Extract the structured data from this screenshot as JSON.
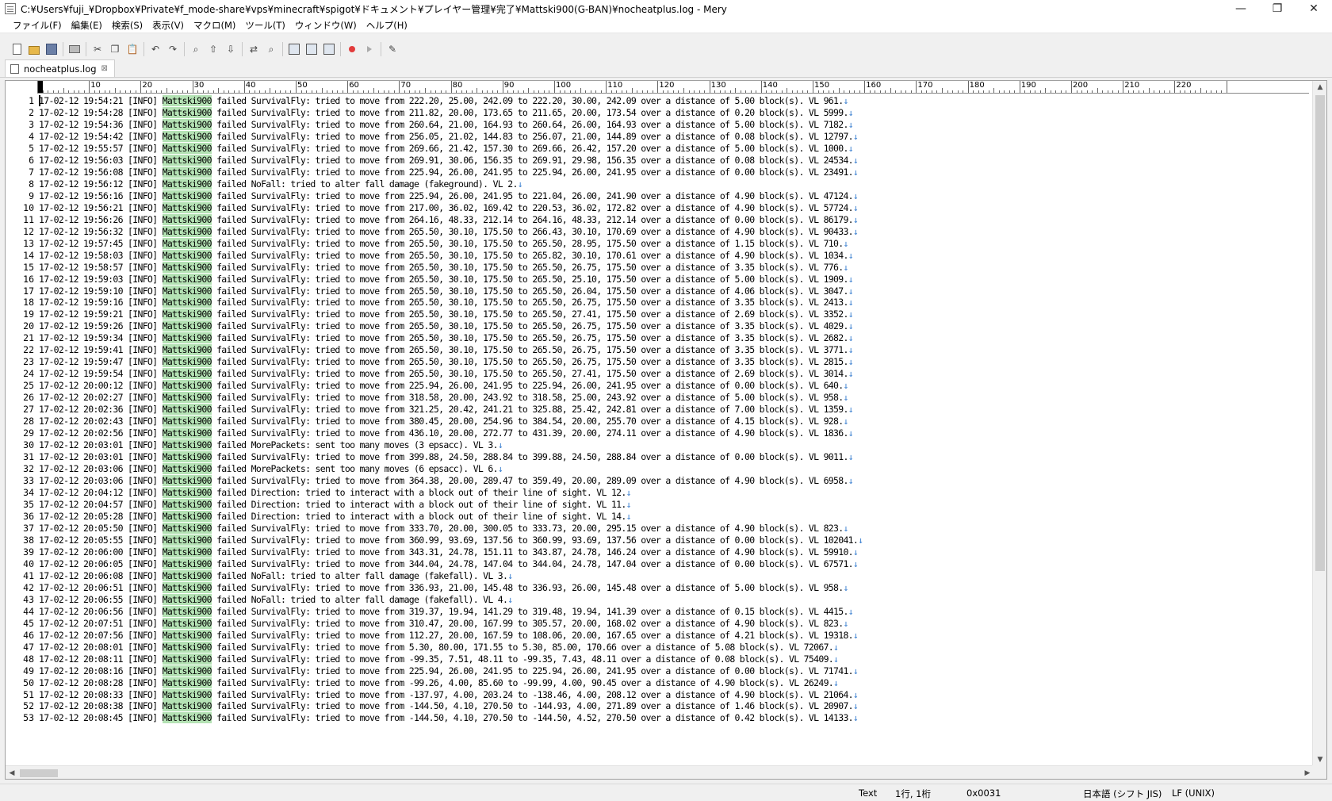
{
  "window": {
    "title": "C:¥Users¥fuji_¥Dropbox¥Private¥f_mode-share¥vps¥minecraft¥spigot¥ドキュメント¥プレイヤー管理¥完了¥Mattski900(G-BAN)¥nocheatplus.log - Mery",
    "minimize": "—",
    "maximize": "❐",
    "close": "✕"
  },
  "menu": [
    "ファイル(F)",
    "編集(E)",
    "検索(S)",
    "表示(V)",
    "マクロ(M)",
    "ツール(T)",
    "ウィンドウ(W)",
    "ヘルプ(H)"
  ],
  "toolbar": {
    "icons": [
      "new-file-icon",
      "open-folder-icon",
      "save-icon",
      "|",
      "print-icon",
      "|",
      "cut-icon",
      "copy-icon",
      "paste-icon",
      "|",
      "undo-icon",
      "redo-icon",
      "|",
      "find-icon",
      "find-up-icon",
      "find-down-icon",
      "|",
      "replace-icon",
      "find-files-icon",
      "|",
      "panel-left-icon",
      "panel-output-icon",
      "panel-split-icon",
      "|",
      "record-macro-icon",
      "play-macro-icon",
      "|",
      "options-icon"
    ]
  },
  "tab": {
    "label": "nocheatplus.log",
    "close": "⊠"
  },
  "ruler": {
    "labels": [
      "10",
      "20",
      "30",
      "40",
      "50",
      "60",
      "70",
      "80",
      "90",
      "100",
      "110",
      "120",
      "130",
      "140",
      "150",
      "160",
      "170",
      "180",
      "190",
      "200",
      "210",
      "220"
    ]
  },
  "editor": {
    "player": "Mattski900",
    "eol_mark": "↓",
    "lines": [
      {
        "n": "1",
        "pre": "17-02-12 19:54:21 [INFO] ",
        "post": " failed SurvivalFly: tried to move from 222.20, 25.00, 242.09 to 222.20, 30.00, 242.09 over a distance of 5.00 block(s). VL 961."
      },
      {
        "n": "2",
        "pre": "17-02-12 19:54:28 [INFO] ",
        "post": " failed SurvivalFly: tried to move from 211.82, 20.00, 173.65 to 211.65, 20.00, 173.54 over a distance of 0.20 block(s). VL 5999."
      },
      {
        "n": "3",
        "pre": "17-02-12 19:54:36 [INFO] ",
        "post": " failed SurvivalFly: tried to move from 260.64, 21.00, 164.93 to 260.64, 26.00, 164.93 over a distance of 5.00 block(s). VL 7182."
      },
      {
        "n": "4",
        "pre": "17-02-12 19:54:42 [INFO] ",
        "post": " failed SurvivalFly: tried to move from 256.05, 21.02, 144.83 to 256.07, 21.00, 144.89 over a distance of 0.08 block(s). VL 12797."
      },
      {
        "n": "5",
        "pre": "17-02-12 19:55:57 [INFO] ",
        "post": " failed SurvivalFly: tried to move from 269.66, 21.42, 157.30 to 269.66, 26.42, 157.20 over a distance of 5.00 block(s). VL 1000."
      },
      {
        "n": "6",
        "pre": "17-02-12 19:56:03 [INFO] ",
        "post": " failed SurvivalFly: tried to move from 269.91, 30.06, 156.35 to 269.91, 29.98, 156.35 over a distance of 0.08 block(s). VL 24534."
      },
      {
        "n": "7",
        "pre": "17-02-12 19:56:08 [INFO] ",
        "post": " failed SurvivalFly: tried to move from 225.94, 26.00, 241.95 to 225.94, 26.00, 241.95 over a distance of 0.00 block(s). VL 23491."
      },
      {
        "n": "8",
        "pre": "17-02-12 19:56:12 [INFO] ",
        "post": " failed NoFall: tried to alter fall damage (fakeground). VL 2."
      },
      {
        "n": "9",
        "pre": "17-02-12 19:56:16 [INFO] ",
        "post": " failed SurvivalFly: tried to move from 225.94, 26.00, 241.95 to 221.04, 26.00, 241.90 over a distance of 4.90 block(s). VL 47124."
      },
      {
        "n": "10",
        "pre": "17-02-12 19:56:21 [INFO] ",
        "post": " failed SurvivalFly: tried to move from 217.00, 36.02, 169.42 to 220.53, 36.02, 172.82 over a distance of 4.90 block(s). VL 57724."
      },
      {
        "n": "11",
        "pre": "17-02-12 19:56:26 [INFO] ",
        "post": " failed SurvivalFly: tried to move from 264.16, 48.33, 212.14 to 264.16, 48.33, 212.14 over a distance of 0.00 block(s). VL 86179."
      },
      {
        "n": "12",
        "pre": "17-02-12 19:56:32 [INFO] ",
        "post": " failed SurvivalFly: tried to move from 265.50, 30.10, 175.50 to 266.43, 30.10, 170.69 over a distance of 4.90 block(s). VL 90433."
      },
      {
        "n": "13",
        "pre": "17-02-12 19:57:45 [INFO] ",
        "post": " failed SurvivalFly: tried to move from 265.50, 30.10, 175.50 to 265.50, 28.95, 175.50 over a distance of 1.15 block(s). VL 710."
      },
      {
        "n": "14",
        "pre": "17-02-12 19:58:03 [INFO] ",
        "post": " failed SurvivalFly: tried to move from 265.50, 30.10, 175.50 to 265.82, 30.10, 170.61 over a distance of 4.90 block(s). VL 1034."
      },
      {
        "n": "15",
        "pre": "17-02-12 19:58:57 [INFO] ",
        "post": " failed SurvivalFly: tried to move from 265.50, 30.10, 175.50 to 265.50, 26.75, 175.50 over a distance of 3.35 block(s). VL 776."
      },
      {
        "n": "16",
        "pre": "17-02-12 19:59:03 [INFO] ",
        "post": " failed SurvivalFly: tried to move from 265.50, 30.10, 175.50 to 265.50, 25.10, 175.50 over a distance of 5.00 block(s). VL 1909."
      },
      {
        "n": "17",
        "pre": "17-02-12 19:59:10 [INFO] ",
        "post": " failed SurvivalFly: tried to move from 265.50, 30.10, 175.50 to 265.50, 26.04, 175.50 over a distance of 4.06 block(s). VL 3047."
      },
      {
        "n": "18",
        "pre": "17-02-12 19:59:16 [INFO] ",
        "post": " failed SurvivalFly: tried to move from 265.50, 30.10, 175.50 to 265.50, 26.75, 175.50 over a distance of 3.35 block(s). VL 2413."
      },
      {
        "n": "19",
        "pre": "17-02-12 19:59:21 [INFO] ",
        "post": " failed SurvivalFly: tried to move from 265.50, 30.10, 175.50 to 265.50, 27.41, 175.50 over a distance of 2.69 block(s). VL 3352."
      },
      {
        "n": "20",
        "pre": "17-02-12 19:59:26 [INFO] ",
        "post": " failed SurvivalFly: tried to move from 265.50, 30.10, 175.50 to 265.50, 26.75, 175.50 over a distance of 3.35 block(s). VL 4029."
      },
      {
        "n": "21",
        "pre": "17-02-12 19:59:34 [INFO] ",
        "post": " failed SurvivalFly: tried to move from 265.50, 30.10, 175.50 to 265.50, 26.75, 175.50 over a distance of 3.35 block(s). VL 2682."
      },
      {
        "n": "22",
        "pre": "17-02-12 19:59:41 [INFO] ",
        "post": " failed SurvivalFly: tried to move from 265.50, 30.10, 175.50 to 265.50, 26.75, 175.50 over a distance of 3.35 block(s). VL 3771."
      },
      {
        "n": "23",
        "pre": "17-02-12 19:59:47 [INFO] ",
        "post": " failed SurvivalFly: tried to move from 265.50, 30.10, 175.50 to 265.50, 26.75, 175.50 over a distance of 3.35 block(s). VL 2815."
      },
      {
        "n": "24",
        "pre": "17-02-12 19:59:54 [INFO] ",
        "post": " failed SurvivalFly: tried to move from 265.50, 30.10, 175.50 to 265.50, 27.41, 175.50 over a distance of 2.69 block(s). VL 3014."
      },
      {
        "n": "25",
        "pre": "17-02-12 20:00:12 [INFO] ",
        "post": " failed SurvivalFly: tried to move from 225.94, 26.00, 241.95 to 225.94, 26.00, 241.95 over a distance of 0.00 block(s). VL 640."
      },
      {
        "n": "26",
        "pre": "17-02-12 20:02:27 [INFO] ",
        "post": " failed SurvivalFly: tried to move from 318.58, 20.00, 243.92 to 318.58, 25.00, 243.92 over a distance of 5.00 block(s). VL 958."
      },
      {
        "n": "27",
        "pre": "17-02-12 20:02:36 [INFO] ",
        "post": " failed SurvivalFly: tried to move from 321.25, 20.42, 241.21 to 325.88, 25.42, 242.81 over a distance of 7.00 block(s). VL 1359."
      },
      {
        "n": "28",
        "pre": "17-02-12 20:02:43 [INFO] ",
        "post": " failed SurvivalFly: tried to move from 380.45, 20.00, 254.96 to 384.54, 20.00, 255.70 over a distance of 4.15 block(s). VL 928."
      },
      {
        "n": "29",
        "pre": "17-02-12 20:02:56 [INFO] ",
        "post": " failed SurvivalFly: tried to move from 436.10, 20.00, 272.77 to 431.39, 20.00, 274.11 over a distance of 4.90 block(s). VL 1836."
      },
      {
        "n": "30",
        "pre": "17-02-12 20:03:01 [INFO] ",
        "post": " failed MorePackets: sent too many moves (3 epsacc). VL 3."
      },
      {
        "n": "31",
        "pre": "17-02-12 20:03:01 [INFO] ",
        "post": " failed SurvivalFly: tried to move from 399.88, 24.50, 288.84 to 399.88, 24.50, 288.84 over a distance of 0.00 block(s). VL 9011."
      },
      {
        "n": "32",
        "pre": "17-02-12 20:03:06 [INFO] ",
        "post": " failed MorePackets: sent too many moves (6 epsacc). VL 6."
      },
      {
        "n": "33",
        "pre": "17-02-12 20:03:06 [INFO] ",
        "post": " failed SurvivalFly: tried to move from 364.38, 20.00, 289.47 to 359.49, 20.00, 289.09 over a distance of 4.90 block(s). VL 6958."
      },
      {
        "n": "34",
        "pre": "17-02-12 20:04:12 [INFO] ",
        "post": " failed Direction: tried to interact with a block out of their line of sight. VL 12."
      },
      {
        "n": "35",
        "pre": "17-02-12 20:04:57 [INFO] ",
        "post": " failed Direction: tried to interact with a block out of their line of sight. VL 11."
      },
      {
        "n": "36",
        "pre": "17-02-12 20:05:28 [INFO] ",
        "post": " failed Direction: tried to interact with a block out of their line of sight. VL 14."
      },
      {
        "n": "37",
        "pre": "17-02-12 20:05:50 [INFO] ",
        "post": " failed SurvivalFly: tried to move from 333.70, 20.00, 300.05 to 333.73, 20.00, 295.15 over a distance of 4.90 block(s). VL 823."
      },
      {
        "n": "38",
        "pre": "17-02-12 20:05:55 [INFO] ",
        "post": " failed SurvivalFly: tried to move from 360.99, 93.69, 137.56 to 360.99, 93.69, 137.56 over a distance of 0.00 block(s). VL 102041."
      },
      {
        "n": "39",
        "pre": "17-02-12 20:06:00 [INFO] ",
        "post": " failed SurvivalFly: tried to move from 343.31, 24.78, 151.11 to 343.87, 24.78, 146.24 over a distance of 4.90 block(s). VL 59910."
      },
      {
        "n": "40",
        "pre": "17-02-12 20:06:05 [INFO] ",
        "post": " failed SurvivalFly: tried to move from 344.04, 24.78, 147.04 to 344.04, 24.78, 147.04 over a distance of 0.00 block(s). VL 67571."
      },
      {
        "n": "41",
        "pre": "17-02-12 20:06:08 [INFO] ",
        "post": " failed NoFall: tried to alter fall damage (fakefall). VL 3."
      },
      {
        "n": "42",
        "pre": "17-02-12 20:06:51 [INFO] ",
        "post": " failed SurvivalFly: tried to move from 336.93, 21.00, 145.48 to 336.93, 26.00, 145.48 over a distance of 5.00 block(s). VL 958."
      },
      {
        "n": "43",
        "pre": "17-02-12 20:06:55 [INFO] ",
        "post": " failed NoFall: tried to alter fall damage (fakefall). VL 4."
      },
      {
        "n": "44",
        "pre": "17-02-12 20:06:56 [INFO] ",
        "post": " failed SurvivalFly: tried to move from 319.37, 19.94, 141.29 to 319.48, 19.94, 141.39 over a distance of 0.15 block(s). VL 4415."
      },
      {
        "n": "45",
        "pre": "17-02-12 20:07:51 [INFO] ",
        "post": " failed SurvivalFly: tried to move from 310.47, 20.00, 167.99 to 305.57, 20.00, 168.02 over a distance of 4.90 block(s). VL 823."
      },
      {
        "n": "46",
        "pre": "17-02-12 20:07:56 [INFO] ",
        "post": " failed SurvivalFly: tried to move from 112.27, 20.00, 167.59 to 108.06, 20.00, 167.65 over a distance of 4.21 block(s). VL 19318."
      },
      {
        "n": "47",
        "pre": "17-02-12 20:08:01 [INFO] ",
        "post": " failed SurvivalFly: tried to move from 5.30, 80.00, 171.55 to 5.30, 85.00, 170.66 over a distance of 5.08 block(s). VL 72067."
      },
      {
        "n": "48",
        "pre": "17-02-12 20:08:11 [INFO] ",
        "post": " failed SurvivalFly: tried to move from -99.35, 7.51, 48.11 to -99.35, 7.43, 48.11 over a distance of 0.08 block(s). VL 75409."
      },
      {
        "n": "49",
        "pre": "17-02-12 20:08:16 [INFO] ",
        "post": " failed SurvivalFly: tried to move from 225.94, 26.00, 241.95 to 225.94, 26.00, 241.95 over a distance of 0.00 block(s). VL 71741."
      },
      {
        "n": "50",
        "pre": "17-02-12 20:08:28 [INFO] ",
        "post": " failed SurvivalFly: tried to move from -99.26, 4.00, 85.60 to -99.99, 4.00, 90.45 over a distance of 4.90 block(s). VL 26249."
      },
      {
        "n": "51",
        "pre": "17-02-12 20:08:33 [INFO] ",
        "post": " failed SurvivalFly: tried to move from -137.97, 4.00, 203.24 to -138.46, 4.00, 208.12 over a distance of 4.90 block(s). VL 21064."
      },
      {
        "n": "52",
        "pre": "17-02-12 20:08:38 [INFO] ",
        "post": " failed SurvivalFly: tried to move from -144.50, 4.10, 270.50 to -144.93, 4.00, 271.89 over a distance of 1.46 block(s). VL 20907."
      },
      {
        "n": "53",
        "pre": "17-02-12 20:08:45 [INFO] ",
        "post": " failed SurvivalFly: tried to move from -144.50, 4.10, 270.50 to -144.50, 4.52, 270.50 over a distance of 0.42 block(s). VL 14133."
      }
    ]
  },
  "status": {
    "mode": "Text",
    "position": "1行, 1桁",
    "code": "0x0031",
    "encoding": "日本語 (シフト JIS)",
    "line_ending": "LF (UNIX)"
  },
  "colors": {
    "highlight": "#b4e2b4",
    "eol": "#3a7fd0"
  }
}
